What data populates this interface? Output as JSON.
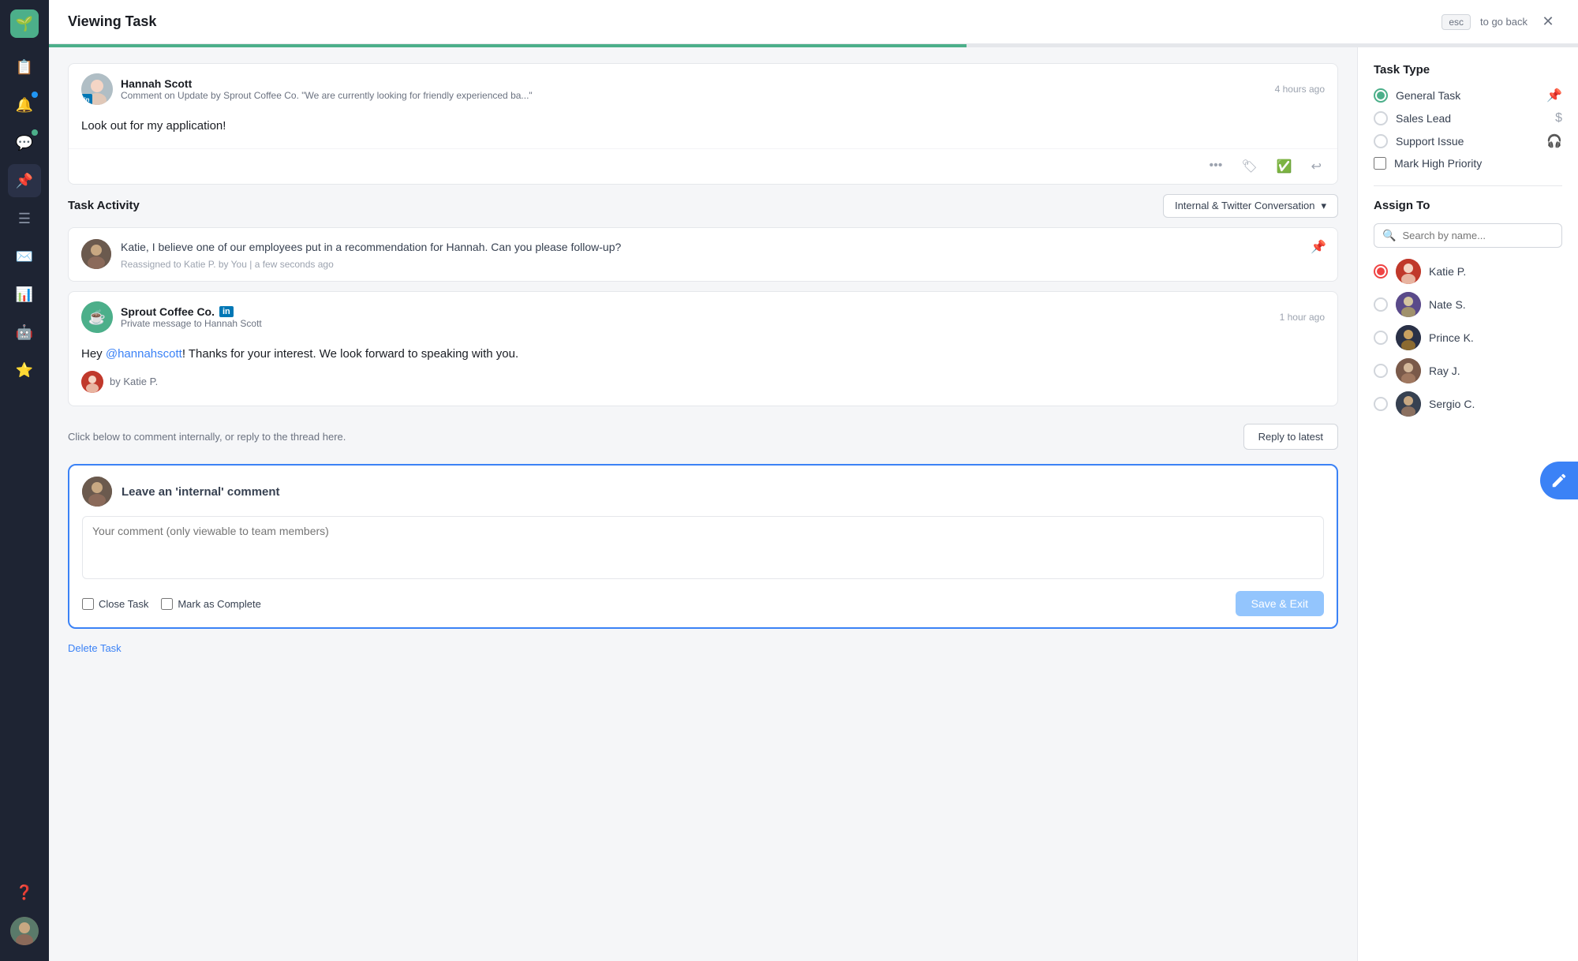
{
  "header": {
    "title": "Viewing Task",
    "esc_label": "esc",
    "go_back": "to go back"
  },
  "sidebar": {
    "logo": "🌱",
    "items": [
      {
        "icon": "📋",
        "label": "feed",
        "active": false
      },
      {
        "icon": "🔔",
        "label": "notifications",
        "active": false,
        "badge": true
      },
      {
        "icon": "💬",
        "label": "messages",
        "active": false,
        "badge": true
      },
      {
        "icon": "📌",
        "label": "tasks",
        "active": true
      },
      {
        "icon": "☰",
        "label": "menu",
        "active": false
      },
      {
        "icon": "✉️",
        "label": "compose",
        "active": false
      },
      {
        "icon": "📊",
        "label": "analytics",
        "active": false
      },
      {
        "icon": "🤖",
        "label": "bot",
        "active": false
      },
      {
        "icon": "⭐",
        "label": "favorites",
        "active": false
      },
      {
        "icon": "❓",
        "label": "help",
        "active": false
      }
    ]
  },
  "main_message": {
    "author": "Hannah Scott",
    "subtitle": "Comment on Update by Sprout Coffee Co. \"We are currently looking for friendly experienced ba...\"",
    "time": "4 hours ago",
    "body": "Look out for my application!"
  },
  "task_activity": {
    "title": "Task Activity",
    "dropdown": "Internal & Twitter Conversation"
  },
  "internal_note": {
    "text": "Katie, I believe one of our employees put in a recommendation for Hannah. Can you please follow-up?",
    "meta": "Reassigned to Katie P. by You  |  a few seconds ago"
  },
  "twitter_msg": {
    "company": "Sprout Coffee Co.",
    "subtitle": "Private message to Hannah Scott",
    "time": "1 hour ago",
    "body": "Hey @hannahscott! Thanks for your interest. We look forward to speaking with you.",
    "by_label": "by Katie P."
  },
  "reply_hint": "Click below to comment internally, or reply to the thread here.",
  "reply_latest_btn": "Reply to latest",
  "comment_box": {
    "title": "Leave an 'internal' comment",
    "placeholder": "Your comment (only viewable to team members)",
    "close_task_label": "Close Task",
    "mark_complete_label": "Mark as Complete",
    "save_btn": "Save & Exit"
  },
  "delete_task": "Delete Task",
  "task_type": {
    "title": "Task Type",
    "options": [
      {
        "label": "General Task",
        "icon": "📌",
        "checked": true
      },
      {
        "label": "Sales Lead",
        "icon": "$",
        "checked": false
      },
      {
        "label": "Support Issue",
        "icon": "🎧",
        "checked": false
      }
    ],
    "high_priority": "Mark High Priority"
  },
  "assign_to": {
    "title": "Assign To",
    "search_placeholder": "Search by name...",
    "assignees": [
      {
        "name": "Katie P.",
        "checked": true,
        "color": "#ef4444"
      },
      {
        "name": "Nate S.",
        "checked": false,
        "color": "#7c3aed"
      },
      {
        "name": "Prince K.",
        "checked": false,
        "color": "#1a1d23"
      },
      {
        "name": "Ray J.",
        "checked": false,
        "color": "#8b6a5a"
      },
      {
        "name": "Sergio C.",
        "checked": false,
        "color": "#374151"
      }
    ]
  }
}
